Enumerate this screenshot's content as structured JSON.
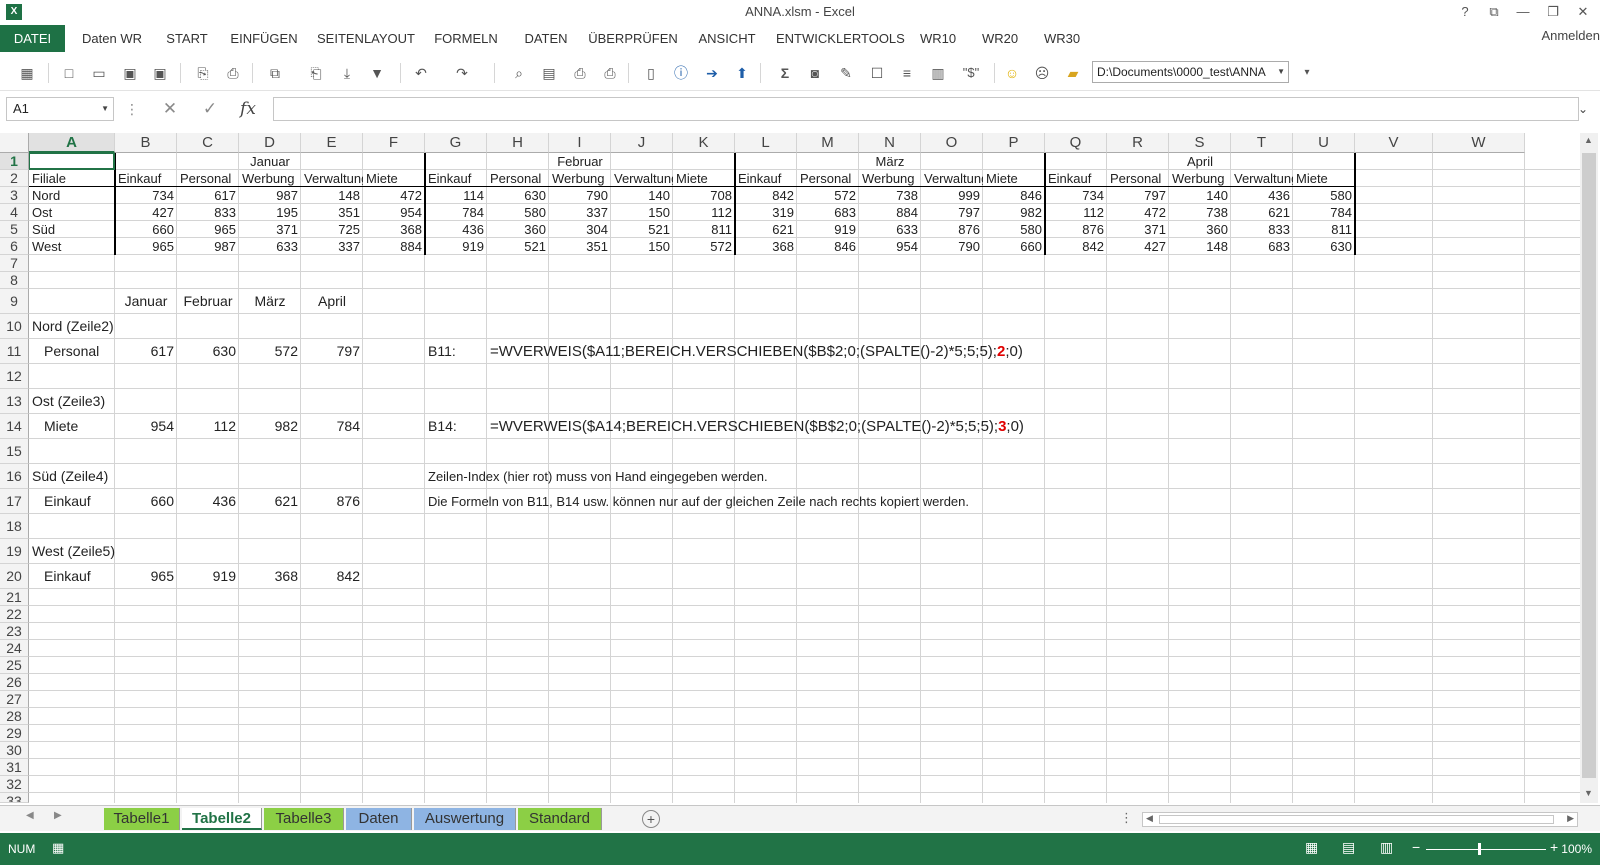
{
  "window": {
    "title": "ANNA.xlsm - Excel",
    "app_icon": "X",
    "help": "?",
    "restore_ribbon": "⧉",
    "minimize": "—",
    "maximize": "❐",
    "close": "✕"
  },
  "ribbon": {
    "tabs": [
      "DATEI",
      "Daten WR",
      "START",
      "EINFÜGEN",
      "SEITENLAYOUT",
      "FORMELN",
      "DATEN",
      "ÜBERPRÜFEN",
      "ANSICHT",
      "ENTWICKLERTOOLS",
      "WR10",
      "WR20",
      "WR30"
    ],
    "active": "DATEI",
    "signin": "Anmelden"
  },
  "toolbar": {
    "path": "D:\\Documents\\0000_test\\ANNA",
    "dollar": "\"$\""
  },
  "formula_bar": {
    "name_box": "A1",
    "fx": "fx",
    "cancel": "✕",
    "enter": "✓",
    "options": "⋮"
  },
  "columns": [
    "A",
    "B",
    "C",
    "D",
    "E",
    "F",
    "G",
    "H",
    "I",
    "J",
    "K",
    "L",
    "M",
    "N",
    "O",
    "P",
    "Q",
    "R",
    "S",
    "T",
    "U",
    "V",
    "W"
  ],
  "rows": [
    "1",
    "2",
    "3",
    "4",
    "5",
    "6",
    "7",
    "8",
    "9",
    "10",
    "11",
    "12",
    "13",
    "14",
    "15",
    "16",
    "17",
    "18",
    "19",
    "20",
    "21",
    "22",
    "23",
    "24",
    "25",
    "26",
    "27",
    "28",
    "29",
    "30",
    "31",
    "32",
    "33"
  ],
  "top_table": {
    "months": [
      "Januar",
      "Februar",
      "März",
      "April"
    ],
    "row_label_header": "Filiale",
    "subheaders": [
      "Einkauf",
      "Personal",
      "Werbung",
      "Verwaltung",
      "Miete"
    ],
    "branches": [
      "Nord",
      "Ost",
      "Süd",
      "West"
    ],
    "values": [
      [
        "734",
        "617",
        "987",
        "148",
        "472",
        "114",
        "630",
        "790",
        "140",
        "708",
        "842",
        "572",
        "738",
        "999",
        "846",
        "734",
        "797",
        "140",
        "436",
        "580"
      ],
      [
        "427",
        "833",
        "195",
        "351",
        "954",
        "784",
        "580",
        "337",
        "150",
        "112",
        "319",
        "683",
        "884",
        "797",
        "982",
        "112",
        "472",
        "738",
        "621",
        "784"
      ],
      [
        "660",
        "965",
        "371",
        "725",
        "368",
        "436",
        "360",
        "304",
        "521",
        "811",
        "621",
        "919",
        "633",
        "876",
        "580",
        "876",
        "371",
        "360",
        "833",
        "811"
      ],
      [
        "965",
        "987",
        "633",
        "337",
        "884",
        "919",
        "521",
        "351",
        "150",
        "572",
        "368",
        "846",
        "954",
        "790",
        "660",
        "842",
        "427",
        "148",
        "683",
        "630"
      ]
    ]
  },
  "lower": {
    "month_headers": [
      "Januar",
      "Februar",
      "März",
      "April"
    ],
    "groups": [
      {
        "title": "Nord (Zeile2)",
        "item": "Personal",
        "values": [
          "617",
          "630",
          "572",
          "797"
        ]
      },
      {
        "title": "Ost (Zeile3)",
        "item": "Miete",
        "values": [
          "954",
          "112",
          "982",
          "784"
        ]
      },
      {
        "title": "Süd (Zeile4)",
        "item": "Einkauf",
        "values": [
          "660",
          "436",
          "621",
          "876"
        ]
      },
      {
        "title": "West (Zeile5)",
        "item": "Einkauf",
        "values": [
          "965",
          "919",
          "368",
          "842"
        ]
      }
    ],
    "formula1": {
      "ref": "B11:",
      "pre": "=WVERWEIS($A11;BEREICH.VERSCHIEBEN($B$2;0;(SPALTE()-2)*5;5;5);",
      "idx": "2",
      "post": ";0)"
    },
    "formula2": {
      "ref": "B14:",
      "pre": "=WVERWEIS($A14;BEREICH.VERSCHIEBEN($B$2;0;(SPALTE()-2)*5;5;5);",
      "idx": "3",
      "post": ";0)"
    },
    "note1": "Zeilen-Index (hier rot) muss von Hand eingegeben werden.",
    "note2": "Die Formeln von B11, B14 usw. können nur auf der gleichen Zeile nach rechts kopiert werden."
  },
  "sheets": [
    {
      "name": "Tabelle1",
      "color": "#8ccf45"
    },
    {
      "name": "Tabelle2",
      "color": "#ffffff"
    },
    {
      "name": "Tabelle3",
      "color": "#8ccf45"
    },
    {
      "name": "Daten",
      "color": "#8eb4e3"
    },
    {
      "name": "Auswertung",
      "color": "#8eb4e3"
    },
    {
      "name": "Standard",
      "color": "#8ccf45"
    }
  ],
  "active_sheet": "Tabelle2",
  "status": {
    "mode": "NUM",
    "zoom": "100%"
  }
}
